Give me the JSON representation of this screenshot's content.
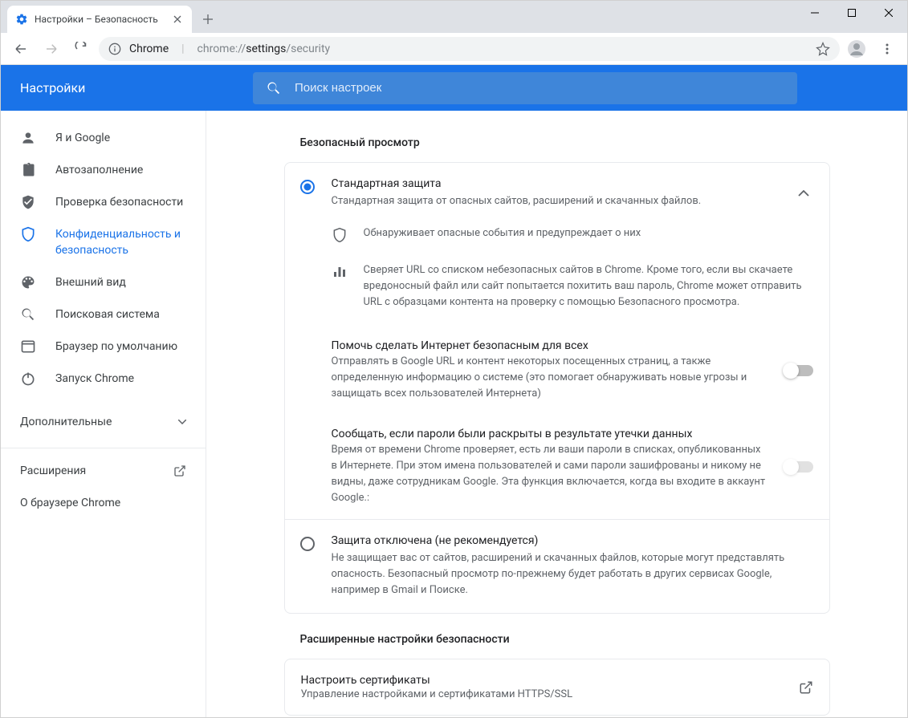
{
  "tab": {
    "title": "Настройки – Безопасность"
  },
  "url": {
    "chrome_label": "Chrome",
    "scheme": "chrome://",
    "host": "settings",
    "path": "/security"
  },
  "header": {
    "title": "Настройки",
    "search_placeholder": "Поиск настроек"
  },
  "sidebar": {
    "items": [
      {
        "label": "Я и Google"
      },
      {
        "label": "Автозаполнение"
      },
      {
        "label": "Проверка безопасности"
      },
      {
        "label": "Конфиденциальность и безопасность"
      },
      {
        "label": "Внешний вид"
      },
      {
        "label": "Поисковая система"
      },
      {
        "label": "Браузер по умолчанию"
      },
      {
        "label": "Запуск Chrome"
      }
    ],
    "advanced": "Дополнительные",
    "extensions": "Расширения",
    "about": "О браузере Chrome"
  },
  "section": {
    "title": "Безопасный просмотр",
    "standard": {
      "title": "Стандартная защита",
      "subtitle": "Стандартная защита от опасных сайтов, расширений и скачанных файлов.",
      "detail1": "Обнаруживает опасные события и предупреждает о них",
      "detail2": "Сверяет URL со списком небезопасных сайтов в Chrome. Кроме того, если вы скачаете вредоносный файл или сайт попытается похитить ваш пароль, Chrome может отправить URL с образцами контента на проверку с помощью Безопасного просмотра.",
      "help": {
        "title": "Помочь сделать Интернет безопасным для всех",
        "desc": "Отправлять в Google URL и контент некоторых посещенных страниц, а также определенную информацию о системе (это помогает обнаруживать новые угрозы и защищать всех пользователей Интернета)"
      },
      "leak": {
        "title": "Сообщать, если пароли были раскрыты в результате утечки данных",
        "desc": "Время от времени Chrome проверяет, есть ли ваши пароли в списках, опубликованных в Интернете. При этом имена пользователей и сами пароли зашифрованы и никому не видны, даже сотрудникам Google. Эта функция включается, когда вы входите в аккаунт Google.:"
      }
    },
    "disabled": {
      "title": "Защита отключена (не рекомендуется)",
      "desc": "Не защищает вас от сайтов, расширений и скачанных файлов, которые могут представлять опасность. Безопасный просмотр по-прежнему будет работать в других сервисах Google, например в Gmail и Поиске."
    },
    "advanced_title": "Расширенные настройки безопасности",
    "certificates": {
      "title": "Настроить сертификаты",
      "desc": "Управление настройками и сертификатами HTTPS/SSL"
    }
  }
}
